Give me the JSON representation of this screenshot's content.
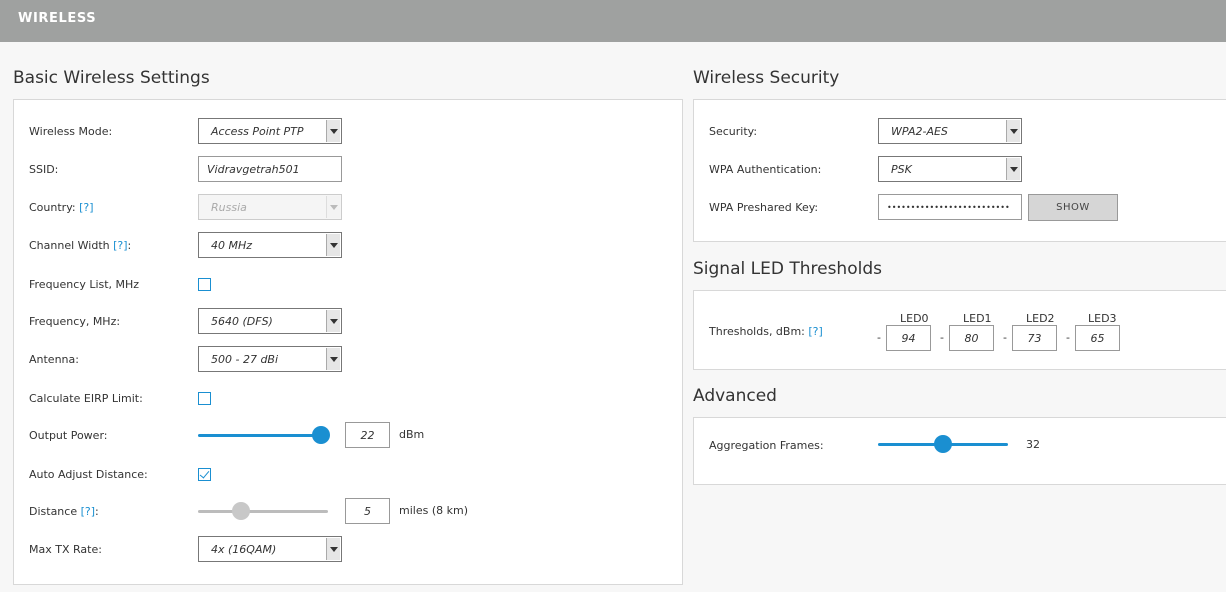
{
  "header": {
    "title": "WIRELESS"
  },
  "basic": {
    "title": "Basic Wireless Settings",
    "wireless_mode_label": "Wireless Mode:",
    "wireless_mode_value": "Access Point PTP",
    "ssid_label": "SSID:",
    "ssid_value": "Vidravgetrah501",
    "country_label": "Country:",
    "country_value": "Russia",
    "channel_width_label": "Channel Width",
    "channel_width_value": "40 MHz",
    "frequency_list_label": "Frequency List, MHz",
    "frequency_label": "Frequency, MHz:",
    "frequency_value": "5640 (DFS)",
    "antenna_label": "Antenna:",
    "antenna_value": "500 - 27 dBi",
    "eirp_label": "Calculate EIRP Limit:",
    "output_power_label": "Output Power:",
    "output_power_value": "22",
    "output_power_unit": "dBm",
    "auto_distance_label": "Auto Adjust Distance:",
    "distance_label": "Distance",
    "distance_value": "5",
    "distance_unit": "miles (8 km)",
    "max_tx_label": "Max TX Rate:",
    "max_tx_value": "4x (16QAM)",
    "help": "[?]",
    "colon": ":"
  },
  "security": {
    "title": "Wireless Security",
    "security_label": "Security:",
    "security_value": "WPA2-AES",
    "wpa_auth_label": "WPA Authentication:",
    "wpa_auth_value": "PSK",
    "psk_label": "WPA Preshared Key:",
    "psk_value": "••••••••••••••••••••••••••",
    "show_button": "SHOW"
  },
  "led": {
    "title": "Signal LED Thresholds",
    "thresholds_label": "Thresholds, dBm:",
    "help": "[?]",
    "dash": "-",
    "leds": [
      {
        "label": "LED0",
        "value": "94"
      },
      {
        "label": "LED1",
        "value": "80"
      },
      {
        "label": "LED2",
        "value": "73"
      },
      {
        "label": "LED3",
        "value": "65"
      }
    ]
  },
  "advanced": {
    "title": "Advanced",
    "aggregation_label": "Aggregation Frames:",
    "aggregation_value": "32"
  },
  "colors": {
    "accent": "#1a8fd1",
    "header": "#9fa1a0"
  }
}
